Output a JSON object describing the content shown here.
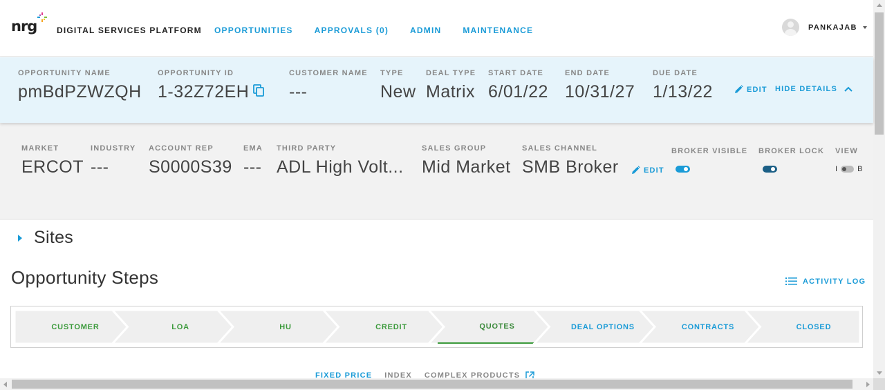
{
  "header": {
    "logo_text": "nrg",
    "platform_title": "DIGITAL SERVICES PLATFORM",
    "nav": [
      {
        "label": "OPPORTUNITIES"
      },
      {
        "label": "APPROVALS (0)"
      },
      {
        "label": "ADMIN"
      },
      {
        "label": "MAINTENANCE"
      }
    ],
    "user_name": "PANKAJAB"
  },
  "opportunity": {
    "name_label": "OPPORTUNITY NAME",
    "name_value": "pmBdPZWZQH",
    "id_label": "OPPORTUNITY ID",
    "id_value": "1-32Z72EH",
    "customer_label": "CUSTOMER NAME",
    "customer_value": "---",
    "type_label": "TYPE",
    "type_value": "New",
    "deal_type_label": "DEAL TYPE",
    "deal_type_value": "Matrix",
    "start_label": "START DATE",
    "start_value": "6/01/22",
    "end_label": "END DATE",
    "end_value": "10/31/27",
    "due_label": "DUE DATE",
    "due_value": "1/13/22",
    "edit_label": "EDIT",
    "hide_details_label": "HIDE DETAILS"
  },
  "market": {
    "market_label": "MARKET",
    "market_value": "ERCOT",
    "industry_label": "INDUSTRY",
    "industry_value": "---",
    "account_rep_label": "ACCOUNT REP",
    "account_rep_value": "S0000S39",
    "ema_label": "EMA",
    "ema_value": "---",
    "third_party_label": "THIRD PARTY",
    "third_party_value": "ADL High Volt...",
    "sales_group_label": "SALES GROUP",
    "sales_group_value": "Mid Market",
    "sales_channel_label": "SALES CHANNEL",
    "sales_channel_value": "SMB Broker",
    "edit_label": "EDIT",
    "broker_visible_label": "BROKER VISIBLE",
    "broker_visible_on": true,
    "broker_lock_label": "BROKER LOCK",
    "broker_lock_on": true,
    "view_label": "VIEW",
    "view_left": "I",
    "view_right": "B"
  },
  "sites_label": "Sites",
  "steps_title": "Opportunity Steps",
  "activity_log_label": "ACTIVITY LOG",
  "steps": [
    {
      "label": "CUSTOMER",
      "state": "done"
    },
    {
      "label": "LOA",
      "state": "done"
    },
    {
      "label": "HU",
      "state": "done"
    },
    {
      "label": "CREDIT",
      "state": "done"
    },
    {
      "label": "QUOTES",
      "state": "active"
    },
    {
      "label": "DEAL OPTIONS",
      "state": "todo"
    },
    {
      "label": "CONTRACTS",
      "state": "todo"
    },
    {
      "label": "CLOSED",
      "state": "todo"
    }
  ],
  "subtabs": {
    "fixed_price": "FIXED PRICE",
    "index": "INDEX",
    "complex_products": "COMPLEX PRODUCTS"
  },
  "colors": {
    "accent": "#1a9bd7",
    "done": "#3b9a3b",
    "panel_blue": "#e6f4fb",
    "panel_gray": "#f2f2f2"
  }
}
